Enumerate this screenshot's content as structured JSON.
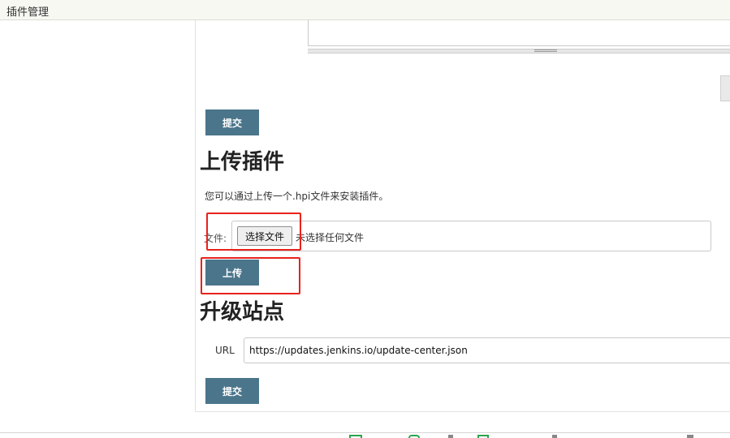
{
  "header": {
    "title": "插件管理"
  },
  "advanced": {
    "submit_label": "提交"
  },
  "upload": {
    "title": "上传插件",
    "description": "您可以通过上传一个.hpi文件来安装插件。",
    "file_label": "文件:",
    "choose_file_label": "选择文件",
    "no_file_text": "未选择任何文件",
    "upload_label": "上传"
  },
  "update_site": {
    "title": "升级站点",
    "url_label": "URL",
    "url_value": "https://updates.jenkins.io/update-center.json",
    "submit_label": "提交"
  },
  "colors": {
    "button": "#4b758b",
    "highlight": "#e8221b",
    "topbar": "#f7f8f2"
  }
}
